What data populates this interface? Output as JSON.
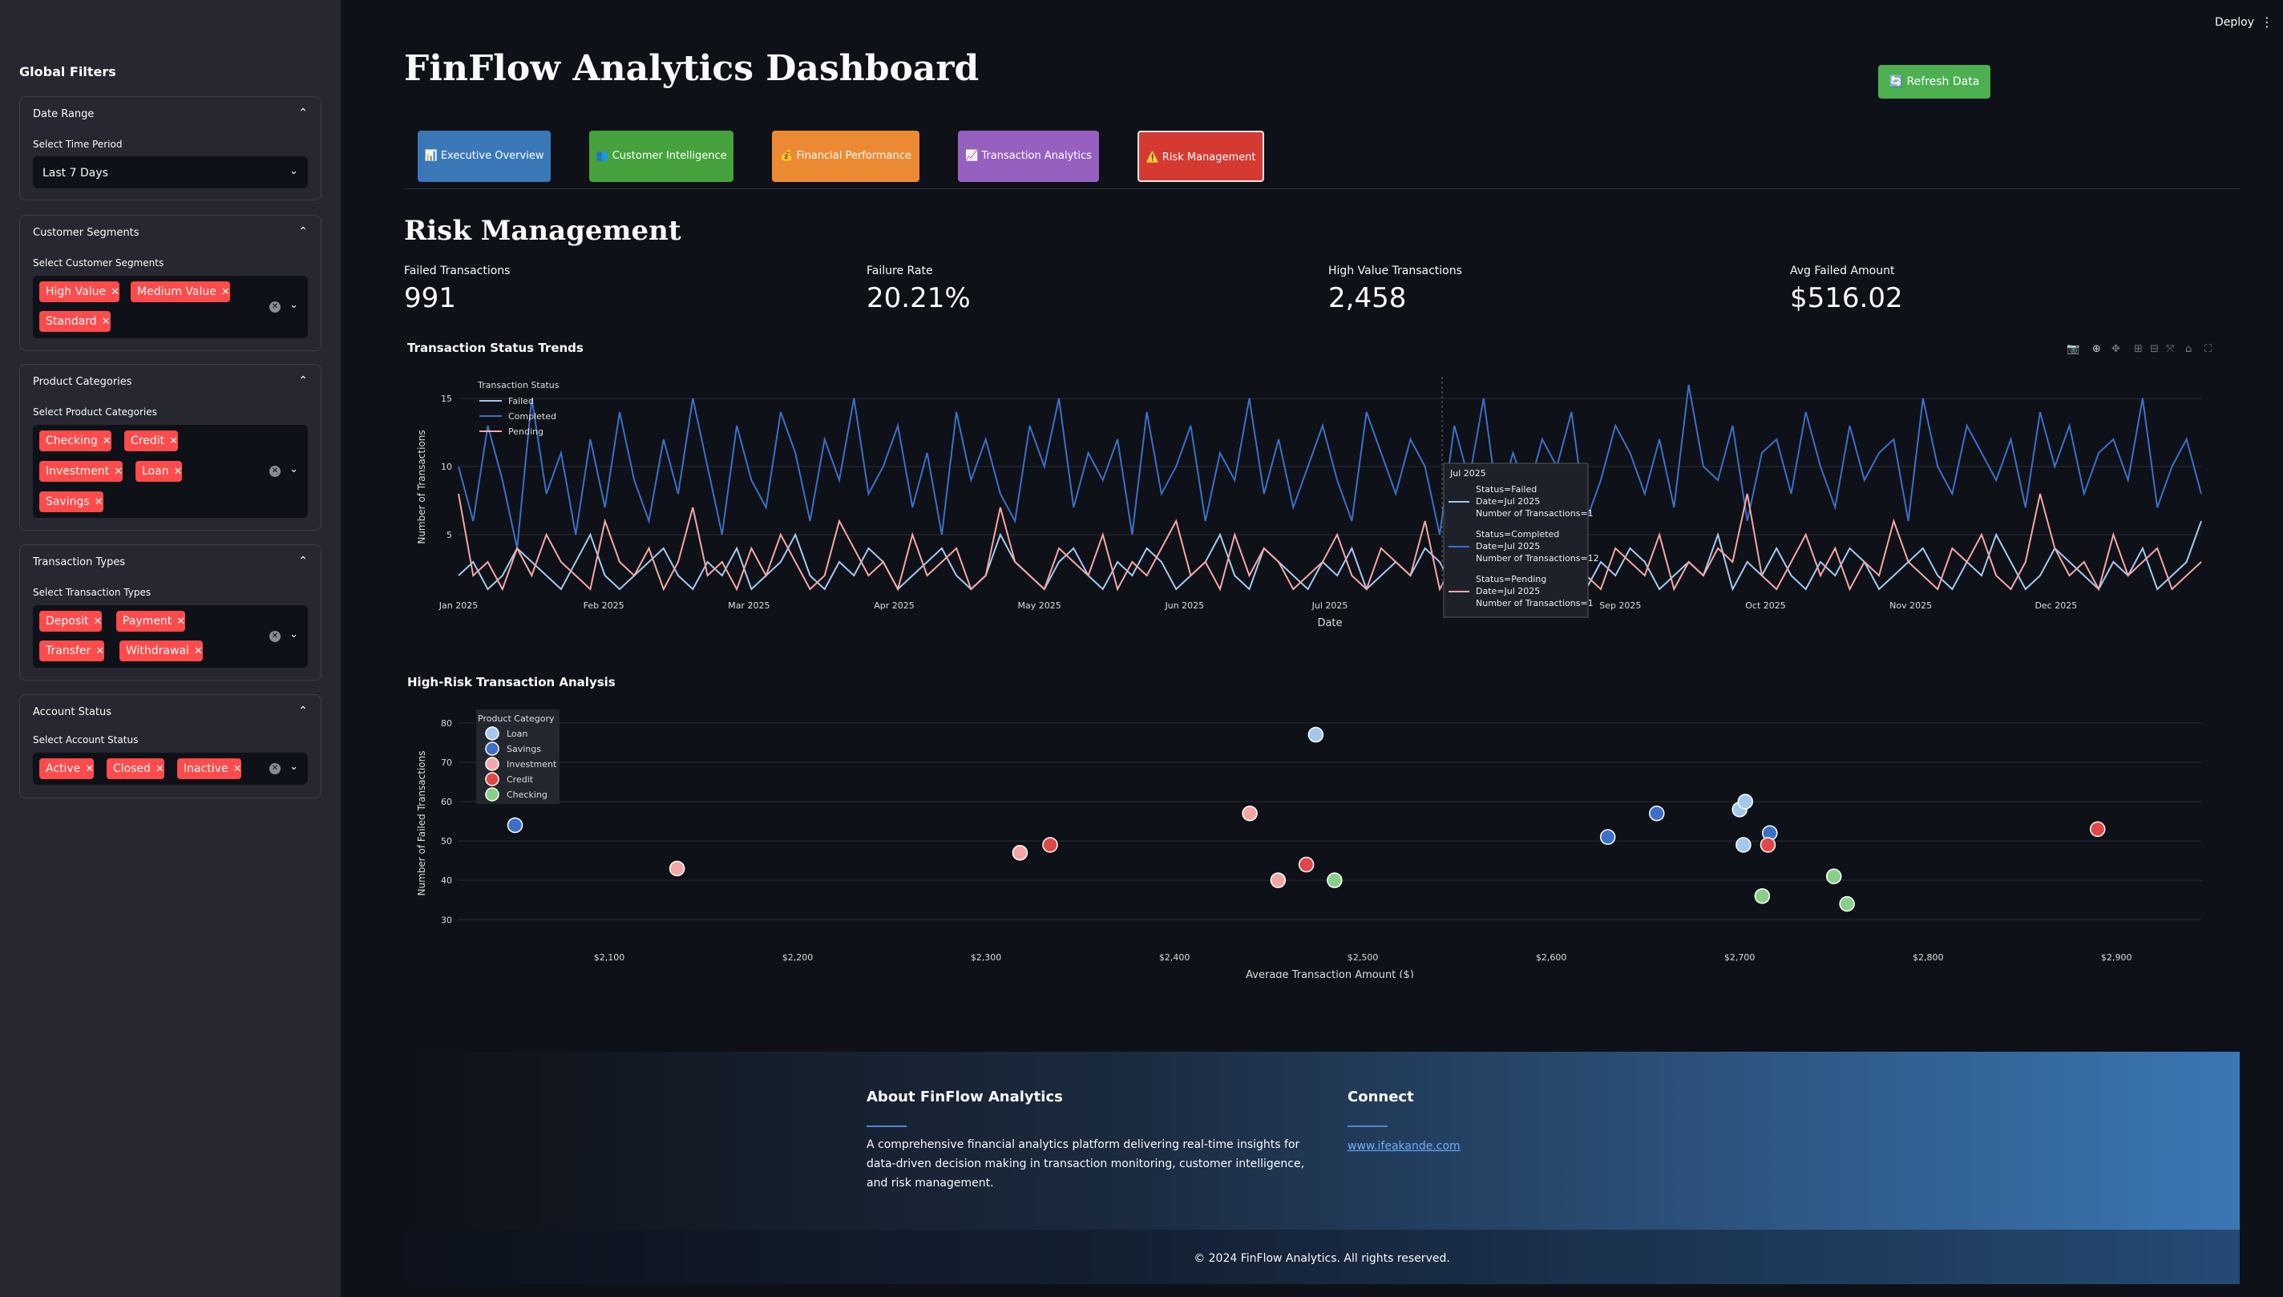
{
  "sidebar": {
    "title": "Global Filters",
    "date": {
      "header": "Date Range",
      "label": "Select Time Period",
      "value": "Last 7 Days"
    },
    "segments": {
      "header": "Customer Segments",
      "label": "Select Customer Segments",
      "chips": [
        "High Value",
        "Medium Value",
        "Standard"
      ]
    },
    "products": {
      "header": "Product Categories",
      "label": "Select Product Categories",
      "chips": [
        "Checking",
        "Credit",
        "Investment",
        "Loan",
        "Savings"
      ]
    },
    "txtypes": {
      "header": "Transaction Types",
      "label": "Select Transaction Types",
      "chips": [
        "Deposit",
        "Payment",
        "Transfer",
        "Withdrawal"
      ]
    },
    "account": {
      "header": "Account Status",
      "label": "Select Account Status",
      "chips": [
        "Active",
        "Closed",
        "Inactive"
      ]
    }
  },
  "header": {
    "deploy": "Deploy",
    "title": "FinFlow Analytics Dashboard",
    "refresh": "🔄 Refresh Data"
  },
  "tabs": [
    {
      "label": "📊 Executive Overview",
      "color": "#3a78b8"
    },
    {
      "label": "👥 Customer Intelligence",
      "color": "#45a23c"
    },
    {
      "label": "💰 Financial Performance",
      "color": "#ec8a33"
    },
    {
      "label": "📈 Transaction Analytics",
      "color": "#9660c0"
    },
    {
      "label": "⚠️ Risk Management",
      "color": "#d43a32"
    }
  ],
  "section": {
    "title": "Risk Management"
  },
  "metrics": [
    {
      "label": "Failed Transactions",
      "value": "991"
    },
    {
      "label": "Failure Rate",
      "value": "20.21%"
    },
    {
      "label": "High Value Transactions",
      "value": "2,458"
    },
    {
      "label": "Avg Failed Amount",
      "value": "$516.02"
    }
  ],
  "chart_data": [
    {
      "type": "line",
      "title": "Transaction Status Trends",
      "xlabel": "Date",
      "ylabel": "Number of Transactions",
      "x_ticks": [
        "Jan 2025",
        "Feb 2025",
        "Mar 2025",
        "Apr 2025",
        "May 2025",
        "Jun 2025",
        "Jul 2025",
        "Aug 2025",
        "Sep 2025",
        "Oct 2025",
        "Nov 2025",
        "Dec 2025"
      ],
      "y_ticks": [
        5,
        10,
        15
      ],
      "ylim": [
        1,
        16
      ],
      "legend_title": "Transaction Status",
      "series": [
        {
          "name": "Failed",
          "color": "#a3c8f0",
          "values": [
            2,
            3,
            1,
            2,
            4,
            3,
            2,
            1,
            3,
            5,
            2,
            1,
            2,
            3,
            4,
            2,
            1,
            3,
            2,
            4,
            1,
            2,
            3,
            5,
            2,
            1,
            3,
            2,
            4,
            3,
            1,
            2,
            3,
            4,
            2,
            1,
            2,
            5,
            3,
            2,
            1,
            3,
            4,
            2,
            1,
            3,
            2,
            4,
            3,
            1,
            2,
            3,
            5,
            2,
            1,
            4,
            3,
            2,
            1,
            3,
            2,
            4,
            1,
            2,
            3,
            2,
            4,
            3,
            1,
            2,
            5,
            3,
            2,
            1,
            3,
            4,
            2,
            1,
            3,
            2,
            4,
            3,
            1,
            2,
            3,
            2,
            5,
            1,
            3,
            2,
            4,
            2,
            1,
            3,
            2,
            4,
            3,
            1,
            2,
            3,
            4,
            2,
            1,
            3,
            2,
            5,
            3,
            1,
            2,
            4,
            3,
            2,
            1,
            3,
            2,
            4,
            1,
            2,
            3,
            6
          ]
        },
        {
          "name": "Completed",
          "color": "#3b70c8",
          "values": [
            10,
            6,
            13,
            9,
            4,
            15,
            8,
            11,
            5,
            12,
            7,
            14,
            9,
            6,
            12,
            8,
            15,
            10,
            5,
            13,
            9,
            7,
            14,
            11,
            6,
            12,
            9,
            15,
            8,
            10,
            13,
            7,
            11,
            5,
            14,
            9,
            12,
            8,
            6,
            13,
            10,
            15,
            7,
            11,
            9,
            12,
            5,
            14,
            8,
            10,
            13,
            6,
            11,
            9,
            15,
            8,
            12,
            7,
            10,
            13,
            9,
            6,
            14,
            11,
            8,
            12,
            10,
            5,
            13,
            9,
            15,
            7,
            11,
            8,
            12,
            10,
            14,
            6,
            9,
            13,
            11,
            8,
            12,
            7,
            16,
            10,
            9,
            13,
            6,
            11,
            12,
            8,
            14,
            10,
            7,
            13,
            9,
            11,
            12,
            6,
            15,
            10,
            8,
            13,
            11,
            9,
            12,
            7,
            14,
            10,
            13,
            8,
            11,
            12,
            9,
            15,
            7,
            10,
            12,
            8
          ]
        },
        {
          "name": "Pending",
          "color": "#f4a6a6",
          "values": [
            8,
            2,
            3,
            1,
            4,
            2,
            5,
            3,
            2,
            1,
            6,
            3,
            2,
            4,
            1,
            3,
            7,
            2,
            3,
            1,
            4,
            2,
            5,
            3,
            1,
            2,
            6,
            4,
            2,
            3,
            1,
            5,
            2,
            3,
            4,
            1,
            2,
            7,
            3,
            2,
            1,
            4,
            3,
            2,
            5,
            1,
            3,
            2,
            4,
            6,
            2,
            3,
            1,
            5,
            2,
            4,
            3,
            1,
            2,
            3,
            5,
            2,
            1,
            4,
            3,
            2,
            6,
            1,
            3,
            2,
            4,
            3,
            1,
            5,
            2,
            3,
            9,
            2,
            1,
            4,
            3,
            2,
            5,
            1,
            3,
            2,
            4,
            3,
            8,
            2,
            1,
            3,
            5,
            2,
            4,
            1,
            3,
            2,
            6,
            3,
            2,
            1,
            4,
            3,
            5,
            2,
            1,
            3,
            8,
            4,
            2,
            3,
            1,
            5,
            2,
            3,
            4,
            1,
            2,
            3
          ]
        }
      ],
      "hover": {
        "header": "Jul 2025",
        "entries": [
          {
            "status": "Status=Failed",
            "date": "Date=Jul 2025",
            "count": "Number of Transactions=1",
            "color": "#a3c8f0"
          },
          {
            "status": "Status=Completed",
            "date": "Date=Jul 2025",
            "count": "Number of Transactions=12",
            "color": "#3b70c8"
          },
          {
            "status": "Status=Pending",
            "date": "Date=Jul 2025",
            "count": "Number of Transactions=1",
            "color": "#f4a6a6"
          }
        ]
      }
    },
    {
      "type": "scatter",
      "title": "High-Risk Transaction Analysis",
      "xlabel": "Average Transaction Amount ($)",
      "ylabel": "Number of Failed Transactions",
      "xlim": [
        2020,
        2945
      ],
      "ylim": [
        27,
        82
      ],
      "x_ticks": [
        2100,
        2200,
        2300,
        2400,
        2500,
        2600,
        2700,
        2800,
        2900
      ],
      "x_tick_labels": [
        "$2,100",
        "$2,200",
        "$2,300",
        "$2,400",
        "$2,500",
        "$2,600",
        "$2,700",
        "$2,800",
        "$2,900"
      ],
      "y_ticks": [
        30,
        40,
        50,
        60,
        70,
        80
      ],
      "legend_title": "Product Category",
      "series": [
        {
          "name": "Loan",
          "color": "#a3c8f0",
          "points": [
            [
              2475,
              77
            ],
            [
              2700,
              58
            ],
            [
              2703,
              60
            ],
            [
              2702,
              49
            ]
          ]
        },
        {
          "name": "Savings",
          "color": "#3b70c8",
          "points": [
            [
              2050,
              54
            ],
            [
              2630,
              51
            ],
            [
              2656,
              57
            ],
            [
              2716,
              52
            ]
          ]
        },
        {
          "name": "Investment",
          "color": "#f4a6a6",
          "points": [
            [
              2136,
              43
            ],
            [
              2318,
              47
            ],
            [
              2440,
              57
            ],
            [
              2455,
              40
            ]
          ]
        },
        {
          "name": "Credit",
          "color": "#e04848",
          "points": [
            [
              2334,
              49
            ],
            [
              2470,
              44
            ],
            [
              2715,
              49
            ],
            [
              2890,
              53
            ]
          ]
        },
        {
          "name": "Checking",
          "color": "#88d08a",
          "points": [
            [
              2485,
              40
            ],
            [
              2712,
              36
            ],
            [
              2750,
              41
            ],
            [
              2757,
              34
            ]
          ]
        }
      ]
    }
  ],
  "footer": {
    "about_title": "About FinFlow Analytics",
    "about_text": "A comprehensive financial analytics platform delivering real-time insights for data-driven decision making in transaction monitoring, customer intelligence, and risk management.",
    "connect_title": "Connect",
    "link": "www.ifeakande.com",
    "copyright": "© 2024 FinFlow Analytics. All rights reserved."
  }
}
